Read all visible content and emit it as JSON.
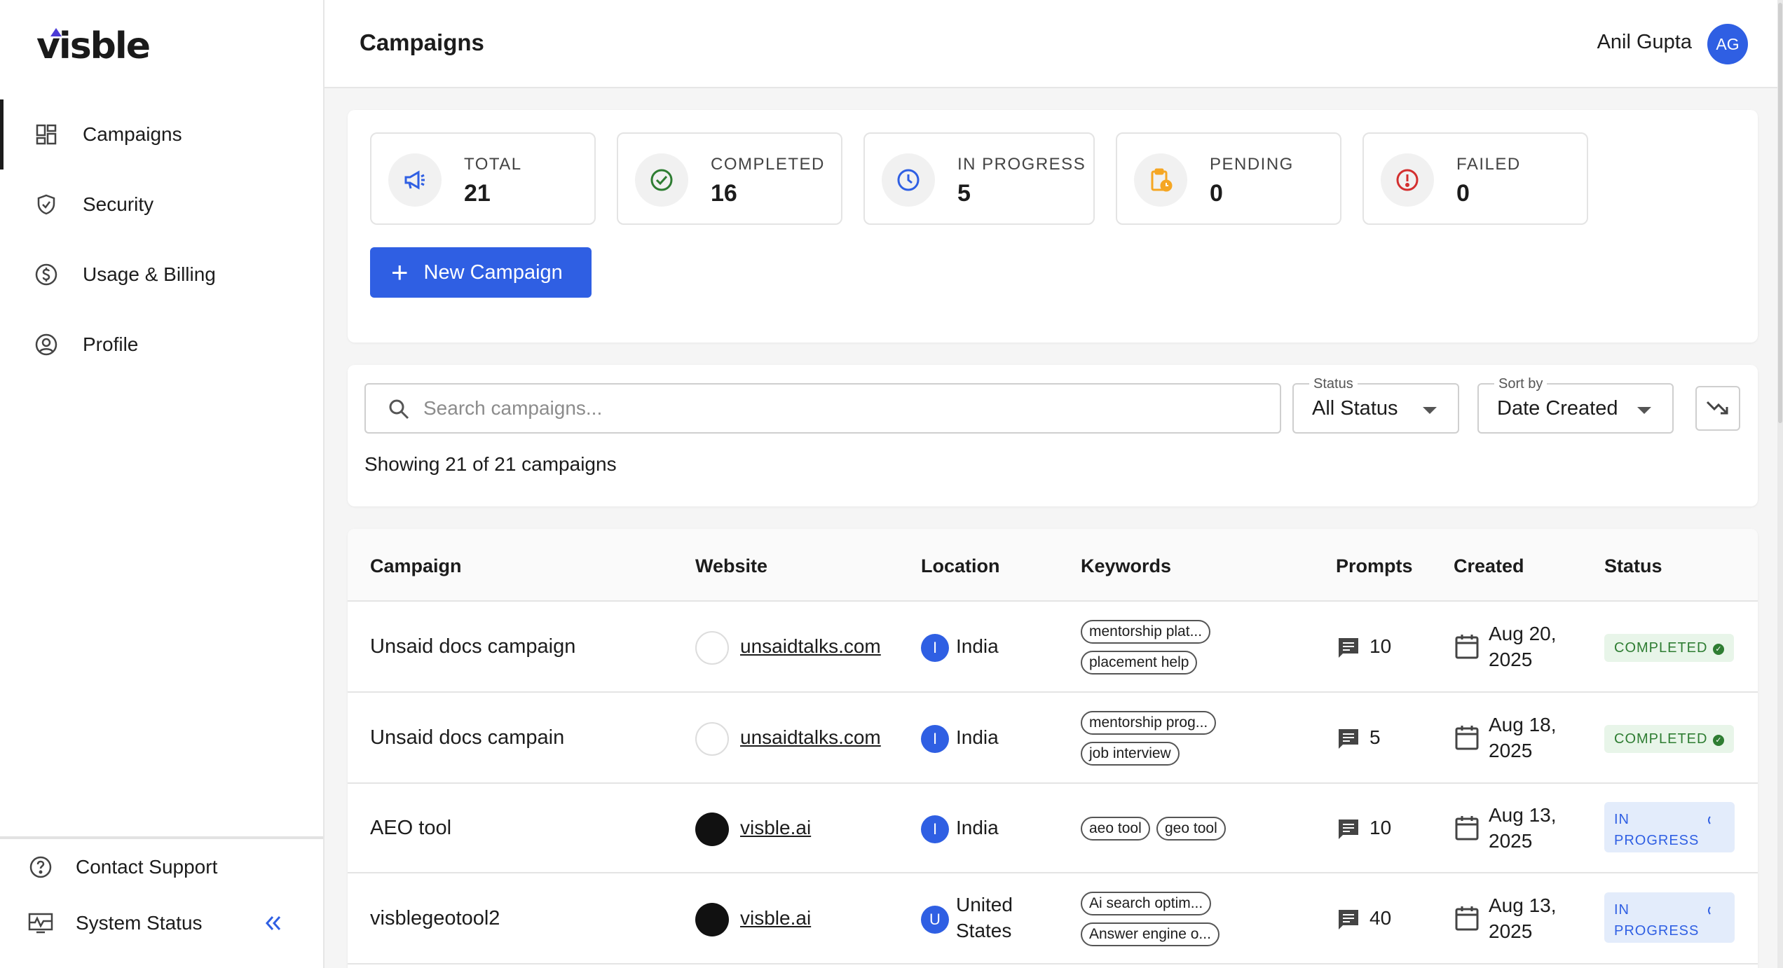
{
  "app": {
    "logo_text": "visble"
  },
  "sidebar": {
    "items": [
      {
        "label": "Campaigns",
        "icon": "dashboard-icon",
        "active": true
      },
      {
        "label": "Security",
        "icon": "shield-icon",
        "active": false
      },
      {
        "label": "Usage & Billing",
        "icon": "dollar-icon",
        "active": false
      },
      {
        "label": "Profile",
        "icon": "user-circle-icon",
        "active": false
      }
    ],
    "bottom": [
      {
        "label": "Contact Support",
        "icon": "help-icon"
      },
      {
        "label": "System Status",
        "icon": "monitor-icon"
      }
    ]
  },
  "header": {
    "title": "Campaigns",
    "user_name": "Anil Gupta",
    "avatar_initials": "AG"
  },
  "stats": {
    "total": {
      "label": "TOTAL",
      "value": "21"
    },
    "completed": {
      "label": "COMPLETED",
      "value": "16"
    },
    "in_progress": {
      "label": "IN PROGRESS",
      "value": "5"
    },
    "pending": {
      "label": "PENDING",
      "value": "0"
    },
    "failed": {
      "label": "FAILED",
      "value": "0"
    }
  },
  "new_campaign_label": "New Campaign",
  "filters": {
    "search_placeholder": "Search campaigns...",
    "status_label": "Status",
    "status_value": "All Status",
    "sort_label": "Sort by",
    "sort_value": "Date Created",
    "showing_text": "Showing 21 of 21 campaigns"
  },
  "table": {
    "headers": [
      "Campaign",
      "Website",
      "Location",
      "Keywords",
      "Prompts",
      "Created",
      "Status"
    ],
    "rows": [
      {
        "campaign": "Unsaid docs campaign",
        "website": "unsaidtalks.com",
        "loc_initial": "I",
        "location": "India",
        "keywords": [
          "mentorship plat...",
          "placement help"
        ],
        "prompts": "10",
        "date_line1": "Aug 20,",
        "date_line2": "2025",
        "status_line1": "COMPLETED",
        "status_line2": ""
      },
      {
        "campaign": "Unsaid docs campain",
        "website": "unsaidtalks.com",
        "loc_initial": "I",
        "location": "India",
        "keywords": [
          "mentorship prog...",
          "job interview"
        ],
        "prompts": "5",
        "date_line1": "Aug 18,",
        "date_line2": "2025",
        "status_line1": "COMPLETED",
        "status_line2": ""
      },
      {
        "campaign": "AEO tool",
        "website": "visble.ai",
        "loc_initial": "I",
        "location": "India",
        "keywords": [
          "aeo tool",
          "geo tool"
        ],
        "prompts": "10",
        "date_line1": "Aug 13,",
        "date_line2": "2025",
        "status_line1": "IN",
        "status_line2": "PROGRESS"
      },
      {
        "campaign": "visblegeotool2",
        "website": "visble.ai",
        "loc_initial": "U",
        "location_line1": "United",
        "location_line2": "States",
        "keywords": [
          "Ai search optim...",
          "Answer engine o..."
        ],
        "prompts": "40",
        "date_line1": "Aug 13,",
        "date_line2": "2025",
        "status_line1": "IN",
        "status_line2": "PROGRESS"
      }
    ]
  },
  "colors": {
    "primary": "#2f5fe3",
    "completed": "#2e7d32",
    "pending": "#f5a623",
    "failed": "#d32f2f"
  }
}
